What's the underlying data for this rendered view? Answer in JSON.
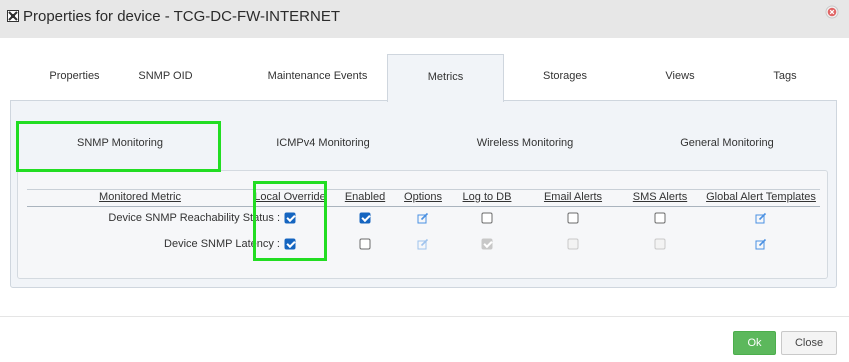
{
  "window": {
    "title": "Properties for device - TCG-DC-FW-INTERNET"
  },
  "tabs": [
    {
      "label": "Properties"
    },
    {
      "label": "SNMP OID"
    },
    {
      "label": "Maintenance Events"
    },
    {
      "label": "Metrics",
      "active": true
    },
    {
      "label": "Storages"
    },
    {
      "label": "Views"
    },
    {
      "label": "Tags"
    }
  ],
  "subtabs": [
    {
      "label": "SNMP Monitoring",
      "active": true
    },
    {
      "label": "ICMPv4 Monitoring"
    },
    {
      "label": "Wireless Monitoring"
    },
    {
      "label": "General Monitoring"
    }
  ],
  "table": {
    "columns": [
      "Monitored Metric",
      "Local Override",
      "Enabled",
      "Options",
      "Log to DB",
      "Email Alerts",
      "SMS Alerts",
      "Global Alert Templates"
    ],
    "rows": [
      {
        "metric": "Device SNMP Reachability Status :",
        "local_override": true,
        "enabled": true,
        "log_to_db": false,
        "email_alerts": false,
        "sms_alerts": false
      },
      {
        "metric": "Device SNMP Latency :",
        "local_override": true,
        "enabled": false,
        "log_to_db": true,
        "email_alerts": false,
        "sms_alerts": false
      }
    ]
  },
  "footer": {
    "ok_label": "Ok",
    "close_label": "Close"
  },
  "colors": {
    "highlight": "#22dd22",
    "ok_button": "#5cb85c",
    "checkbox_checked": "#1565c0",
    "edit_icon": "#4a90e2"
  },
  "icons": {
    "title": "device-icon",
    "close": "close-circle-icon",
    "options": "edit-icon",
    "templates": "edit-icon"
  }
}
